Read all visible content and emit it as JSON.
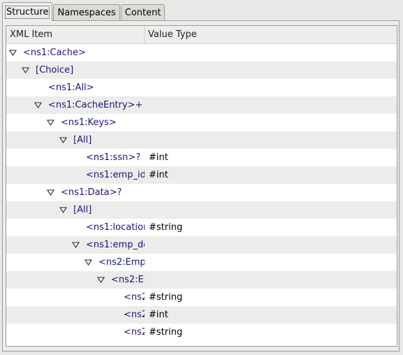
{
  "tabs": [
    {
      "label": "Structure",
      "active": true
    },
    {
      "label": "Namespaces",
      "active": false
    },
    {
      "label": "Content",
      "active": false
    }
  ],
  "columns": {
    "xml_item": "XML Item",
    "value_type": "Value Type"
  },
  "rows": [
    {
      "label": "<ns1:Cache>",
      "type": "",
      "depth": 0,
      "expanded": true
    },
    {
      "label": "[Choice]",
      "type": "",
      "depth": 1,
      "expanded": true
    },
    {
      "label": "<ns1:All>",
      "type": "",
      "depth": 2,
      "expanded": null
    },
    {
      "label": "<ns1:CacheEntry>+",
      "type": "",
      "depth": 2,
      "expanded": true
    },
    {
      "label": "<ns1:Keys>",
      "type": "",
      "depth": 3,
      "expanded": true
    },
    {
      "label": "[All]",
      "type": "",
      "depth": 4,
      "expanded": true
    },
    {
      "label": "<ns1:ssn>?",
      "type": "#int",
      "depth": 5,
      "expanded": null
    },
    {
      "label": "<ns1:emp_id",
      "type": "#int",
      "depth": 5,
      "expanded": null
    },
    {
      "label": "<ns1:Data>?",
      "type": "",
      "depth": 3,
      "expanded": true
    },
    {
      "label": "[All]",
      "type": "",
      "depth": 4,
      "expanded": true
    },
    {
      "label": "<ns1:locatior",
      "type": "#string",
      "depth": 5,
      "expanded": null
    },
    {
      "label": "<ns1:emp_de",
      "type": "",
      "depth": 5,
      "expanded": true
    },
    {
      "label": "<ns2:Emp",
      "type": "",
      "depth": 6,
      "expanded": true
    },
    {
      "label": "<ns2:Er",
      "type": "",
      "depth": 7,
      "expanded": true
    },
    {
      "label": "<ns2",
      "type": "#string",
      "depth": 8,
      "expanded": null
    },
    {
      "label": "<ns2",
      "type": "#int",
      "depth": 8,
      "expanded": null
    },
    {
      "label": "<ns2",
      "type": "#string",
      "depth": 8,
      "expanded": null
    }
  ],
  "icons": {
    "expander_expanded": "triangle-down-icon"
  },
  "colors": {
    "label_text": "#16167a",
    "alt_row": "#ececeb",
    "background": "#e8e8e7"
  }
}
